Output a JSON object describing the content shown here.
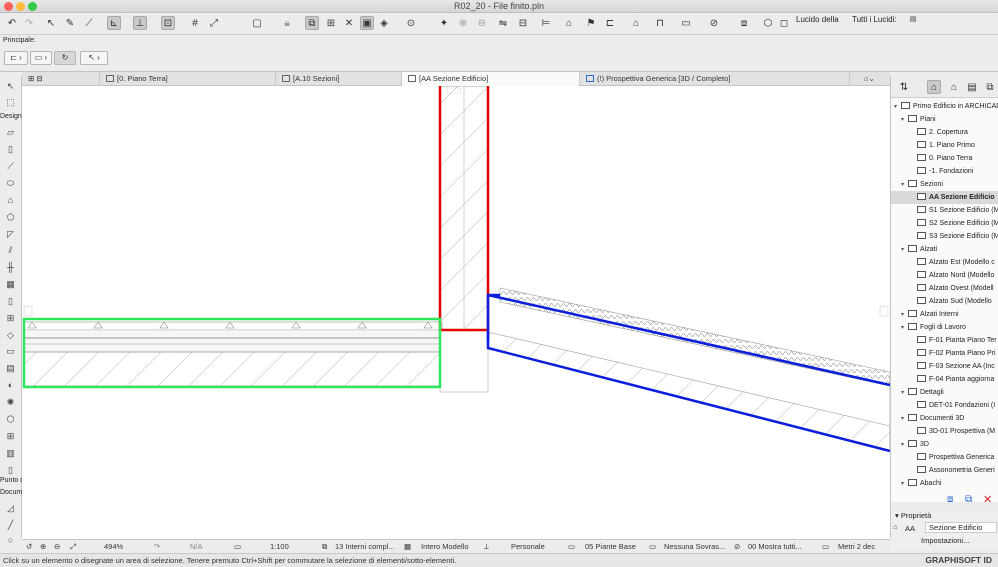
{
  "window": {
    "title": "R02_20 - File finito.pln"
  },
  "toolbar": {
    "lucido_label": "Lucido della",
    "tutti_label": "Tutti i Lucidi:"
  },
  "infobox": {
    "label": "Principale:"
  },
  "toolbox": {
    "design_label": "Design",
    "punto_label": "Punto di",
    "docume_label": "Docume"
  },
  "tabs": [
    {
      "label": "[0. Piano Terra]"
    },
    {
      "label": "[A.10 Sezioni]"
    },
    {
      "label": "[AA Sezione Edificio]"
    },
    {
      "label": "(!) Prospettiva Generica [3D / Completo]"
    }
  ],
  "navigator": {
    "items": [
      {
        "label": "Primo Edificio in ARCHICAD",
        "level": 0,
        "icon": "building-icon"
      },
      {
        "label": "Piani",
        "level": 1,
        "icon": "folder-icon"
      },
      {
        "label": "2. Copertura",
        "level": 2,
        "icon": "floor-icon"
      },
      {
        "label": "1. Piano Primo",
        "level": 2,
        "icon": "floor-icon"
      },
      {
        "label": "0. Piano Terra",
        "level": 2,
        "icon": "floor-icon"
      },
      {
        "label": "-1. Fondazioni",
        "level": 2,
        "icon": "floor-icon"
      },
      {
        "label": "Sezioni",
        "level": 1,
        "icon": "folder-icon"
      },
      {
        "label": "AA Sezione Edificio",
        "level": 2,
        "icon": "section-icon",
        "selected": true
      },
      {
        "label": "S1 Sezione Edificio (M",
        "level": 2,
        "icon": "section-icon"
      },
      {
        "label": "S2 Sezione Edificio (M",
        "level": 2,
        "icon": "section-icon"
      },
      {
        "label": "S3 Sezione Edificio (M",
        "level": 2,
        "icon": "section-icon"
      },
      {
        "label": "Alzati",
        "level": 1,
        "icon": "folder-icon"
      },
      {
        "label": "Alzato Est (Modello c",
        "level": 2,
        "icon": "elevation-icon"
      },
      {
        "label": "Alzato Nord (Modello",
        "level": 2,
        "icon": "elevation-icon"
      },
      {
        "label": "Alzato Ovest (Modell",
        "level": 2,
        "icon": "elevation-icon"
      },
      {
        "label": "Alzato Sud (Modello",
        "level": 2,
        "icon": "elevation-icon"
      },
      {
        "label": "Alzati Interni",
        "level": 1,
        "icon": "interior-icon"
      },
      {
        "label": "Fogli di Lavoro",
        "level": 1,
        "icon": "worksheet-icon"
      },
      {
        "label": "F-01 Pianta Piano Ter",
        "level": 2,
        "icon": "worksheet-icon"
      },
      {
        "label": "F-02 Pianta Piano Pri",
        "level": 2,
        "icon": "worksheet-icon"
      },
      {
        "label": "F-03 Sezione AA (Inc",
        "level": 2,
        "icon": "worksheet-icon"
      },
      {
        "label": "F-04 Pianta aggiorna",
        "level": 2,
        "icon": "worksheet-icon"
      },
      {
        "label": "Dettagli",
        "level": 1,
        "icon": "detail-icon"
      },
      {
        "label": "DET-01 Fondazioni (I",
        "level": 2,
        "icon": "detail-icon"
      },
      {
        "label": "Documenti 3D",
        "level": 1,
        "icon": "document3d-icon"
      },
      {
        "label": "3D-01 Prospettiva (M",
        "level": 2,
        "icon": "document3d-icon"
      },
      {
        "label": "3D",
        "level": 1,
        "icon": "cube-icon"
      },
      {
        "label": "Prospettiva Generica",
        "level": 2,
        "icon": "cube-icon"
      },
      {
        "label": "Assonometria Generi",
        "level": 2,
        "icon": "cube-icon"
      },
      {
        "label": "Abachi",
        "level": 1,
        "icon": "schedule-icon"
      }
    ]
  },
  "properties": {
    "title": "Proprietà",
    "id": "AA",
    "name": "Sezione Edificio",
    "settings_button": "Impostazioni..."
  },
  "statusbar": {
    "zoom": "494%",
    "angle": "N/A",
    "scale": "1:100",
    "layer_combo": "13 Interni compl...",
    "model_view": "Intero Modello",
    "pen_set": "Personale",
    "view_option": "05 Piante Base",
    "override": "Nessuna Sovras...",
    "renovation": "00 Mostra tutti...",
    "dimension": "Metri 2 dec"
  },
  "message": {
    "text": "Click su un elemento o disegnate un area di selezione. Tenere premuto Ctrl+Shift per commutare la selezione di elementi/sotto-elementi.",
    "brand": "GRAPHISOFT ID"
  },
  "colors": {
    "wall_selection": "#e60000",
    "slab_selection": "#2ee65a",
    "roof_selection": "#0a1edc"
  }
}
